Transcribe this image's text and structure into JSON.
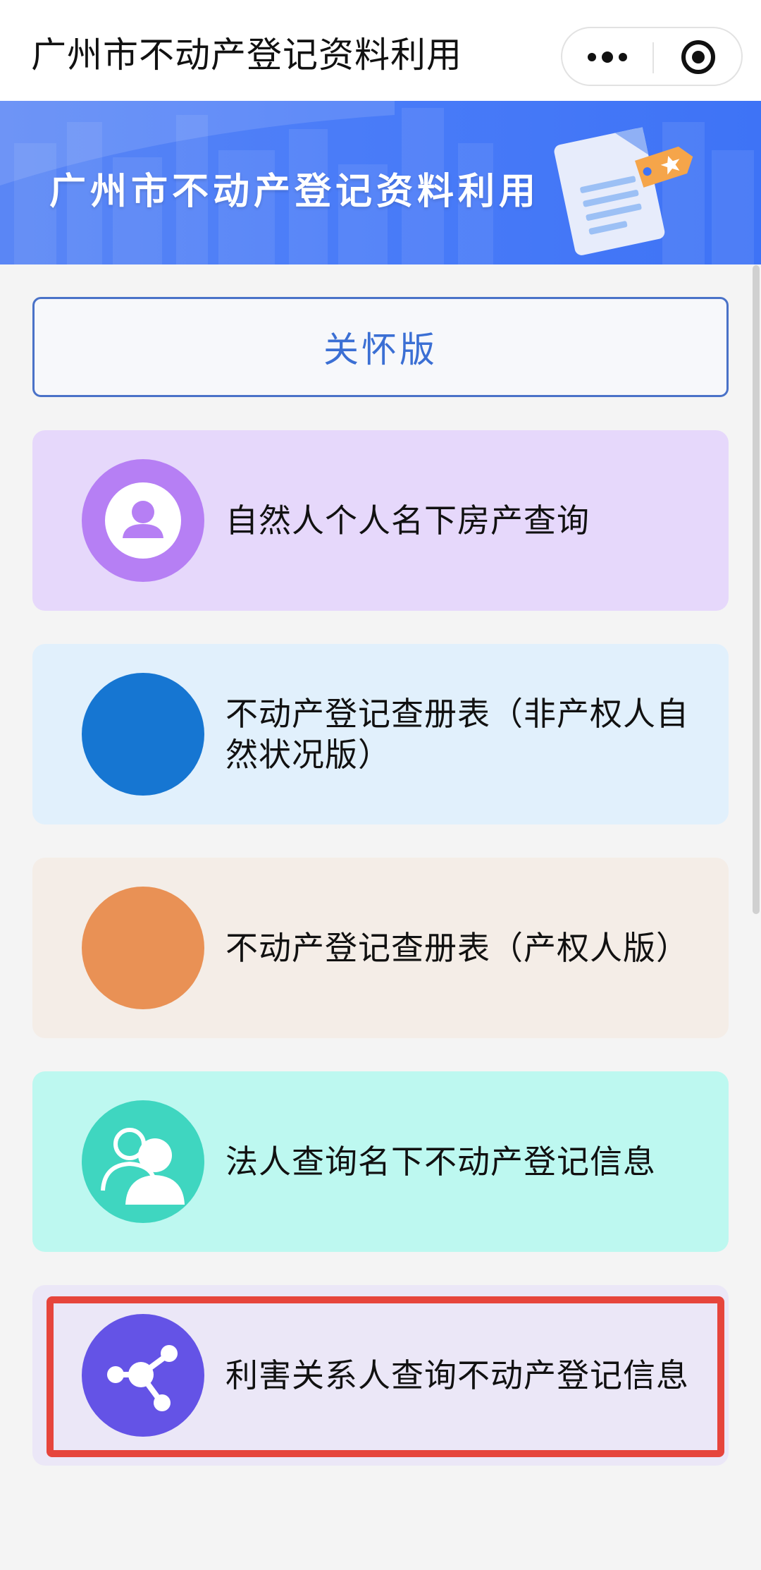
{
  "titlebar": {
    "title": "广州市不动产登记资料利用",
    "more_icon": "more-dots-icon",
    "close_icon": "close-target-icon"
  },
  "banner": {
    "title": "广州市不动产登记资料利用",
    "illustration": "document-tag-icon"
  },
  "care_button": {
    "label": "关怀版"
  },
  "services": [
    {
      "label": "自然人个人名下房产查询",
      "icon": "person-icon",
      "color": "#b67ff4"
    },
    {
      "label": "不动产登记查册表（非产权人自然状况版）",
      "icon": "blank-circle",
      "color": "#1676d2"
    },
    {
      "label": "不动产登记查册表（产权人版）",
      "icon": "blank-circle",
      "color": "#e99155"
    },
    {
      "label": "法人查询名下不动产登记信息",
      "icon": "people-icon",
      "color": "#3fd6c0"
    },
    {
      "label": "利害关系人查询不动产登记信息",
      "icon": "share-network-icon",
      "color": "#6453e6"
    }
  ],
  "colors": {
    "accent": "#3b6fd4",
    "banner": "#4a7cf8",
    "highlight": "#e6453c"
  }
}
